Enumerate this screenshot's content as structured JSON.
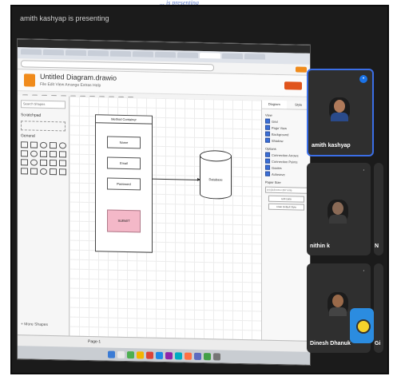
{
  "caption": "... is presenting",
  "meeting": {
    "presenting_text": "amith kashyap is presenting"
  },
  "screen": {
    "browser_tabs": 12,
    "app": {
      "doc_title": "Untitled Diagram.drawio",
      "menu": "File  Edit  View  Arrange  Extras  Help",
      "left_panel": {
        "search_placeholder": "Search Shapes",
        "scratchpad_label": "Scratchpad",
        "general_label": "General",
        "more_shapes": "+ More Shapes"
      },
      "diagram": {
        "container_title": "Method Container",
        "fields": [
          "Name",
          "Email",
          "Password"
        ],
        "submit_label": "SUBMIT",
        "db_label": "Database"
      },
      "right_panel": {
        "tabs": [
          "Diagram",
          "Style"
        ],
        "view_label": "View",
        "options": [
          "Grid",
          "Page View",
          "Background",
          "Shadow"
        ],
        "options_label": "Options",
        "option_items": [
          "Connection Arrows",
          "Connection Points",
          "Guides",
          "Autosave"
        ],
        "paper_size_label": "Paper Size",
        "paper_size_value": "A4 (210 mm x 297 mm)",
        "buttons": [
          "Edit Data",
          "Clear Default Style"
        ]
      },
      "page_tab": "Page-1"
    }
  },
  "participants": [
    {
      "name": "amith kashyap",
      "speaking": true
    },
    {
      "name": "nithin k",
      "speaking": false
    },
    {
      "name": "Dinesh Dhanuk",
      "speaking": false
    },
    {
      "name": "N",
      "speaking": false
    },
    {
      "name": "Gi",
      "speaking": false
    }
  ],
  "colors": {
    "active_speaker_border": "#3b6ee6",
    "drawio_orange": "#f08b1c",
    "submit_fill": "#f4b8c8"
  }
}
